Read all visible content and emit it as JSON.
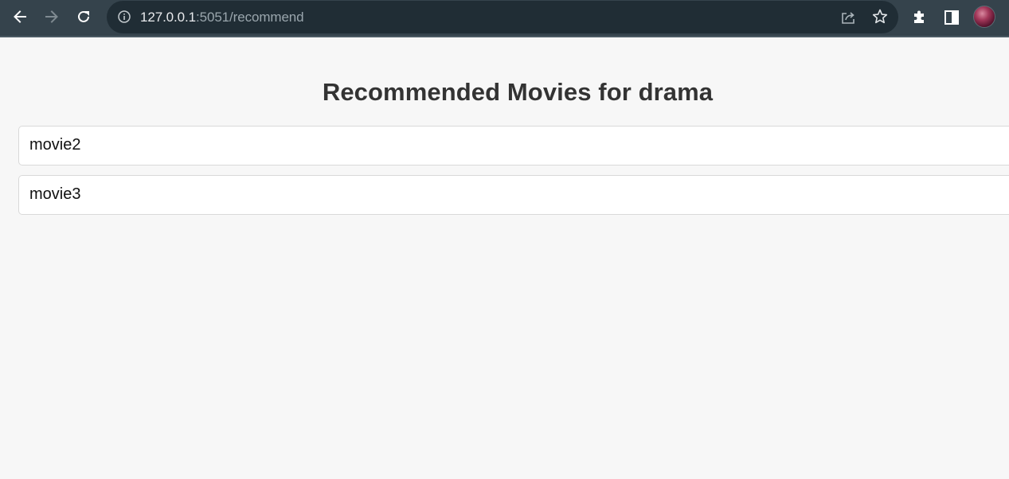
{
  "browser": {
    "url_host": "127.0.0.1",
    "url_rest": ":5051/recommend"
  },
  "page": {
    "heading": "Recommended Movies for drama",
    "movies": [
      "movie2",
      "movie3"
    ]
  }
}
